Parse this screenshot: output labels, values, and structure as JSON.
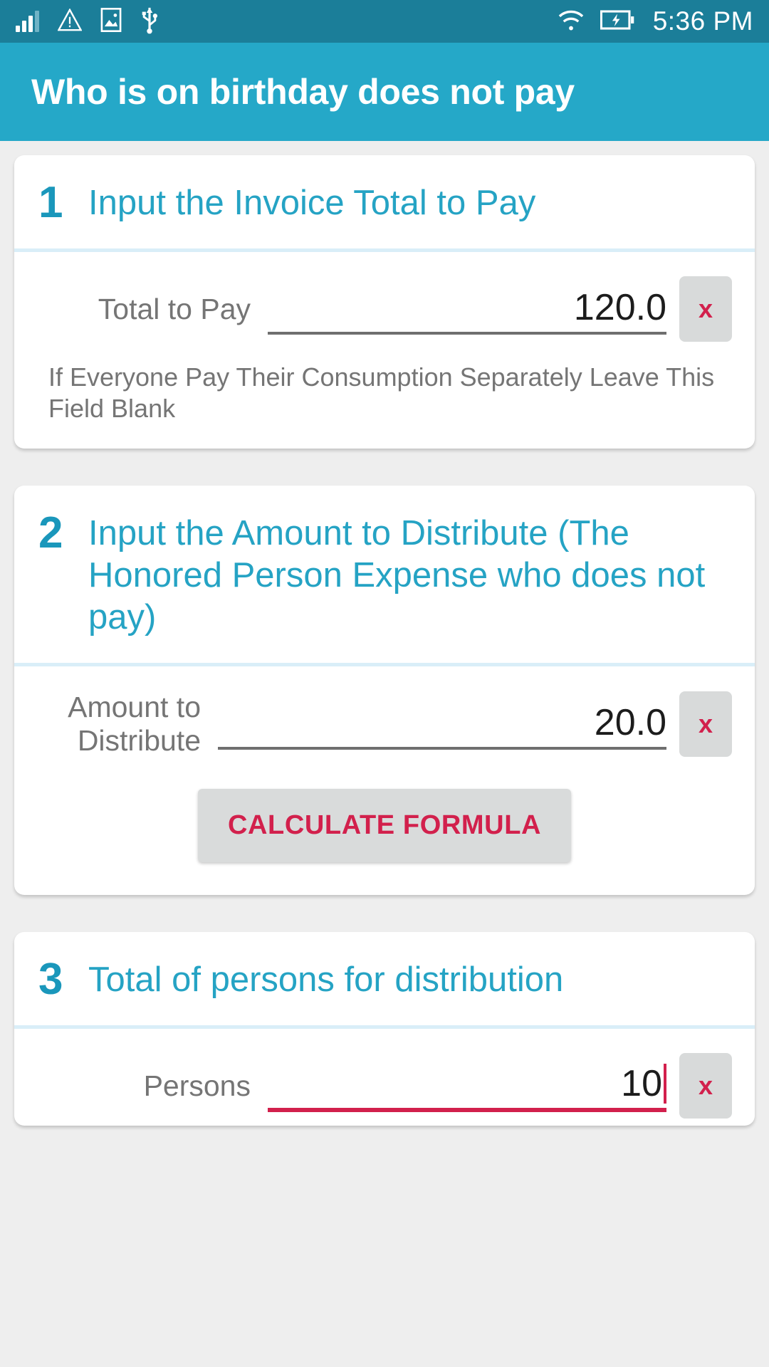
{
  "status_bar": {
    "time": "5:36 PM",
    "icons": [
      "signal-bars-icon",
      "warning-triangle-icon",
      "screenshot-image-icon",
      "usb-icon",
      "wifi-icon",
      "battery-charging-icon"
    ],
    "background_color": "#1b7e99"
  },
  "app_bar": {
    "title": "Who is on birthday does not pay",
    "background_color": "#25a8c8"
  },
  "colors": {
    "accent_teal": "#25a3c4",
    "number_teal": "#1a97bb",
    "crimson": "#d2204c",
    "divider_blue": "#d9eef8",
    "label_gray": "#757575",
    "button_gray": "#d9dbdb"
  },
  "cards": [
    {
      "number": "1",
      "heading": "Input the Invoice Total to Pay",
      "field_label": "Total to Pay",
      "field_value": "120.0",
      "clear_label": "x",
      "helper_text": "If Everyone Pay Their Consumption Separately Leave This Field Blank"
    },
    {
      "number": "2",
      "heading": "Input the Amount to Distribute (The Honored Person Expense who does not pay)",
      "field_label": "Amount to Distribute",
      "field_value": "20.0",
      "clear_label": "x",
      "button_label": "CALCULATE FORMULA"
    },
    {
      "number": "3",
      "heading": "Total of persons for distribution",
      "field_label": "Persons",
      "field_value": "10",
      "clear_label": "x"
    }
  ]
}
